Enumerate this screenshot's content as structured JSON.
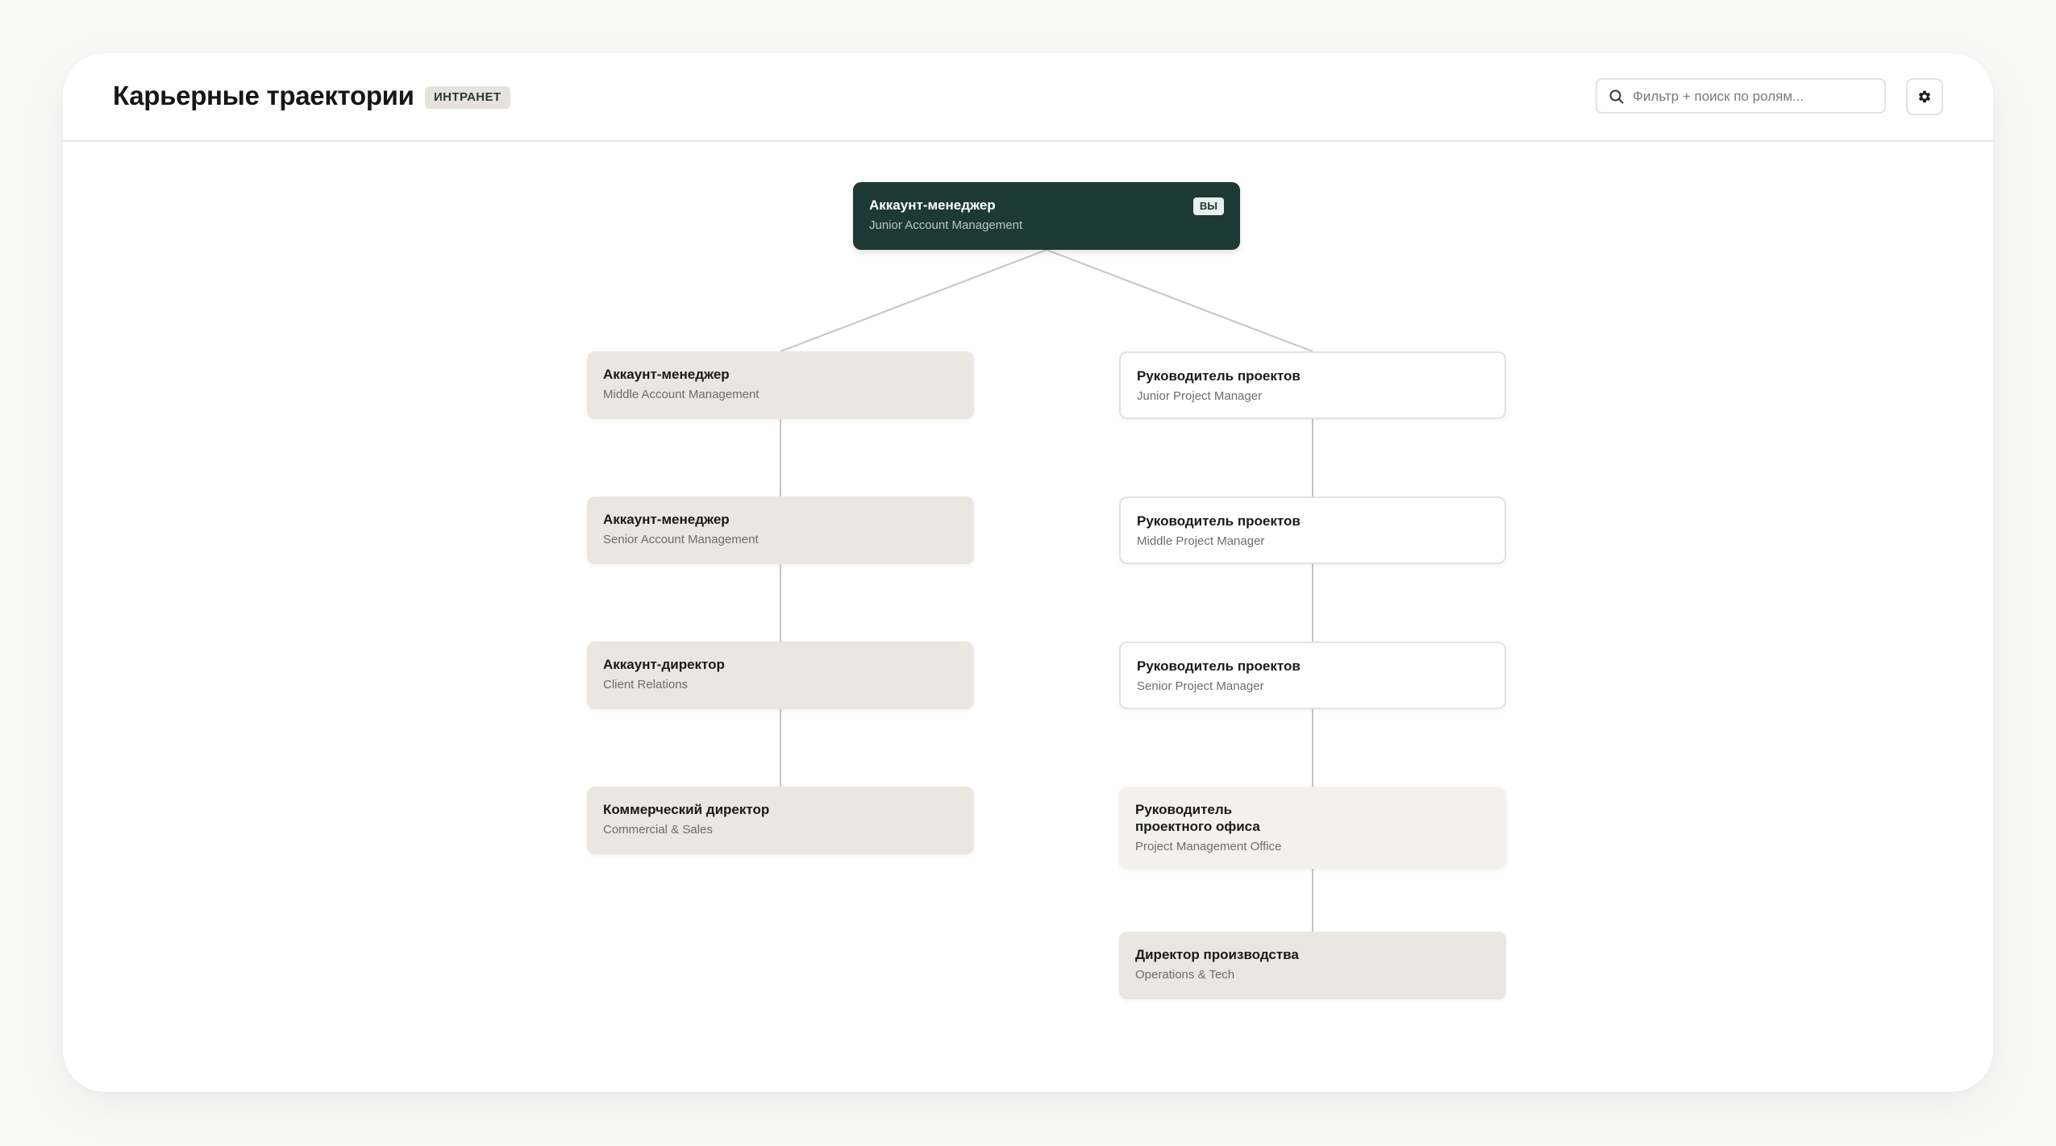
{
  "header": {
    "title": "Карьерные траектории",
    "badge": "ИНТРАНЕТ",
    "search": {
      "placeholder": "Фильтр + поиск по ролям...",
      "value": ""
    }
  },
  "icons": {
    "search": "search-icon",
    "settings": "gear-icon"
  },
  "colors": {
    "current_node": "#1c3a33",
    "node_tan": "#ebe6df",
    "node_light": "#f3f1ec",
    "node_white": "#ffffff",
    "connector": "#c9c5bc"
  },
  "tree": {
    "root": {
      "title": "Аккаунт-менеджер",
      "subtitle": "Junior Account Management",
      "tag": "ВЫ"
    },
    "left": [
      {
        "title": "Аккаунт-менеджер",
        "subtitle": "Middle Account Management"
      },
      {
        "title": "Аккаунт-менеджер",
        "subtitle": "Senior Account Management"
      },
      {
        "title": "Аккаунт-директор",
        "subtitle": "Client Relations"
      },
      {
        "title": "Коммерческий директор",
        "subtitle": "Commercial & Sales"
      }
    ],
    "right": [
      {
        "title": "Руководитель проектов",
        "subtitle": "Junior Project Manager"
      },
      {
        "title": "Руководитель проектов",
        "subtitle": "Middle Project Manager"
      },
      {
        "title": "Руководитель проектов",
        "subtitle": "Senior Project Manager"
      },
      {
        "title": "Руководитель\nпроектного офиса",
        "subtitle": "Project Management Office"
      },
      {
        "title": "Директор производства",
        "subtitle": "Operations & Tech"
      }
    ]
  }
}
